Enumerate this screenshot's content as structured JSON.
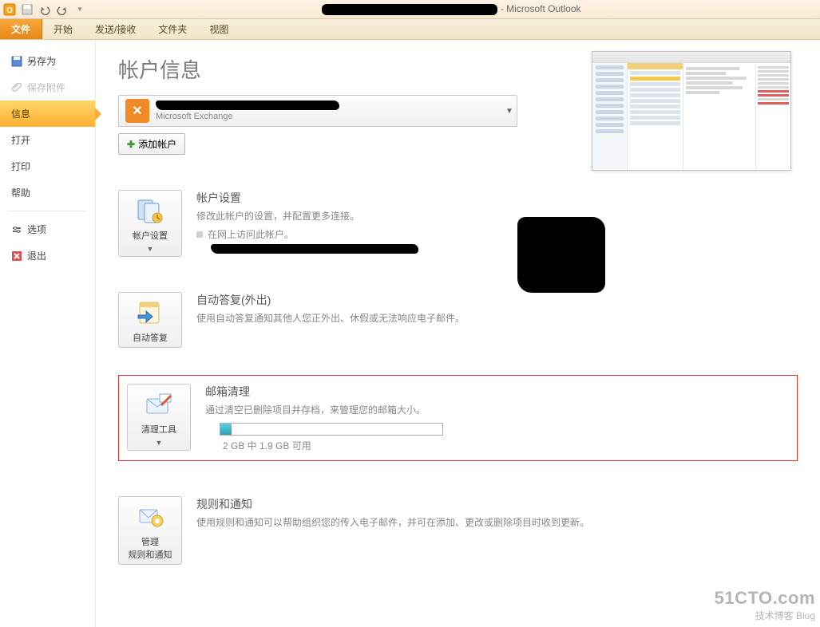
{
  "app": {
    "title_suffix": " - Microsoft Outlook"
  },
  "ribbon": {
    "file": "文件",
    "home": "开始",
    "sendrecv": "发送/接收",
    "folder": "文件夹",
    "view": "视图"
  },
  "nav": {
    "save_as": "另存为",
    "save_attach": "保存附件",
    "info": "信息",
    "open": "打开",
    "print": "打印",
    "help": "帮助",
    "options": "选项",
    "exit": "退出"
  },
  "page": {
    "title": "帐户信息",
    "exchange_type": "Microsoft Exchange",
    "add_account": "添加帐户"
  },
  "sections": {
    "settings": {
      "btn": "帐户设置",
      "title": "帐户设置",
      "desc": "修改此帐户的设置，并配置更多连接。",
      "bullet": "在网上访问此帐户。"
    },
    "autoreply": {
      "btn": "自动答复",
      "title": "自动答复(外出)",
      "desc": "使用自动答复通知其他人您正外出、休假或无法响应电子邮件。"
    },
    "cleanup": {
      "btn": "清理工具",
      "title": "邮箱清理",
      "desc": "通过清空已删除项目并存档，来管理您的邮箱大小。",
      "quota": "2 GB 中 1.9 GB 可用"
    },
    "rules": {
      "btn_l1": "管理",
      "btn_l2": "规则和通知",
      "title": "规则和通知",
      "desc": "使用规则和通知可以帮助组织您的传入电子邮件，并可在添加、更改或删除项目时收到更新。"
    }
  },
  "watermark": {
    "line1": "51CTO.com",
    "line2": "技术博客  Blog"
  }
}
